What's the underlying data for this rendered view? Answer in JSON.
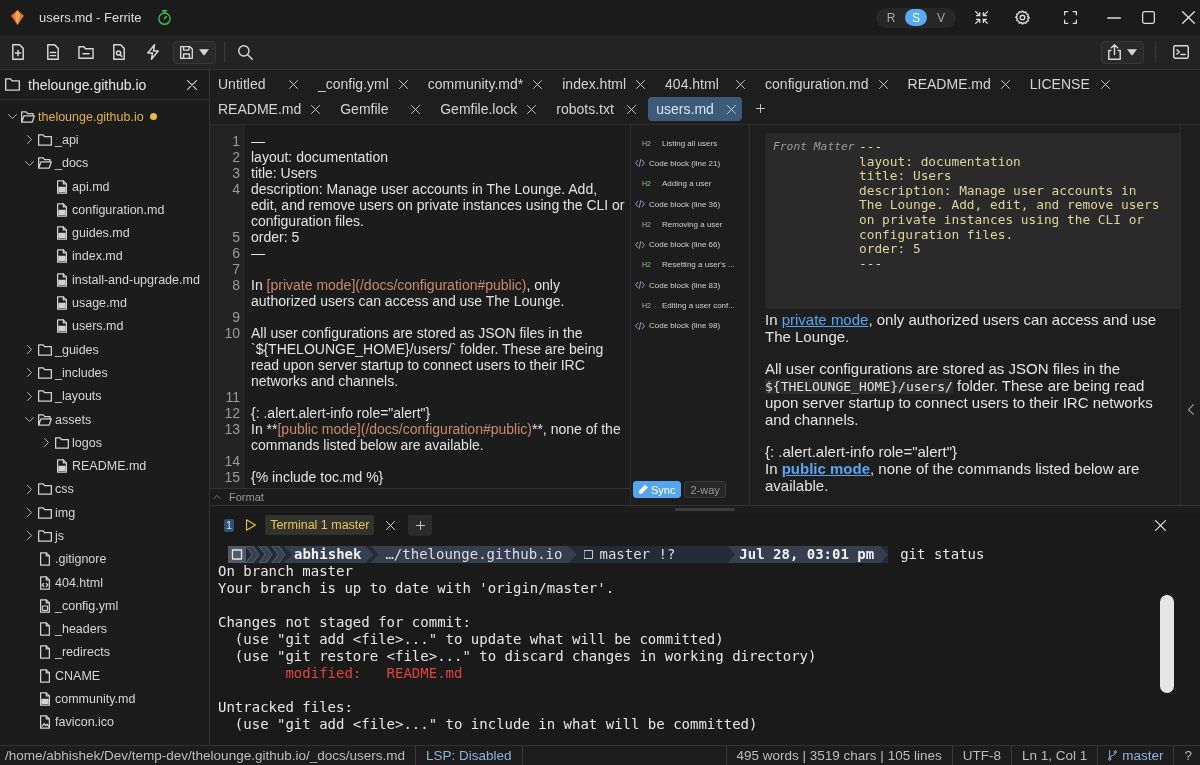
{
  "window": {
    "title": "users.md - Ferrite",
    "view_modes": [
      {
        "label": "R",
        "selected": false
      },
      {
        "label": "S",
        "selected": true
      },
      {
        "label": "V",
        "selected": false
      }
    ]
  },
  "sidebar": {
    "title": "thelounge.github.io",
    "tree": [
      {
        "name": "thelounge.github.io",
        "kind": "folder",
        "expanded": true,
        "modified": true,
        "children": [
          {
            "name": "_api",
            "kind": "folder",
            "expanded": false,
            "modified": false
          },
          {
            "name": "_docs",
            "kind": "folder",
            "expanded": true,
            "modified": false,
            "children": [
              {
                "name": "api.md",
                "kind": "markdown",
                "modified": false
              },
              {
                "name": "configuration.md",
                "kind": "markdown",
                "modified": false
              },
              {
                "name": "guides.md",
                "kind": "markdown",
                "modified": false
              },
              {
                "name": "index.md",
                "kind": "markdown",
                "modified": false
              },
              {
                "name": "install-and-upgrade.md",
                "kind": "markdown",
                "modified": false
              },
              {
                "name": "usage.md",
                "kind": "markdown",
                "modified": false
              },
              {
                "name": "users.md",
                "kind": "markdown",
                "modified": false
              }
            ]
          },
          {
            "name": "_guides",
            "kind": "folder",
            "expanded": false,
            "modified": false
          },
          {
            "name": "_includes",
            "kind": "folder",
            "expanded": false,
            "modified": false
          },
          {
            "name": "_layouts",
            "kind": "folder",
            "expanded": false,
            "modified": false
          },
          {
            "name": "assets",
            "kind": "folder",
            "expanded": true,
            "modified": false,
            "children": [
              {
                "name": "logos",
                "kind": "folder",
                "expanded": false,
                "modified": false
              },
              {
                "name": "README.md",
                "kind": "markdown",
                "modified": false
              }
            ]
          },
          {
            "name": "css",
            "kind": "folder",
            "expanded": false,
            "modified": false
          },
          {
            "name": "img",
            "kind": "folder",
            "expanded": false,
            "modified": false
          },
          {
            "name": "js",
            "kind": "folder",
            "expanded": false,
            "modified": false
          },
          {
            "name": ".gitignore",
            "kind": "file",
            "modified": false
          },
          {
            "name": "404.html",
            "kind": "html",
            "modified": false
          },
          {
            "name": "_config.yml",
            "kind": "config",
            "modified": false
          },
          {
            "name": "_headers",
            "kind": "file",
            "modified": false
          },
          {
            "name": "_redirects",
            "kind": "file",
            "modified": false
          },
          {
            "name": "CNAME",
            "kind": "file",
            "modified": false
          },
          {
            "name": "community.md",
            "kind": "markdown",
            "modified": false
          },
          {
            "name": "favicon.ico",
            "kind": "image",
            "modified": false
          }
        ]
      }
    ]
  },
  "tabs": [
    {
      "label": "Untitled",
      "selected": false
    },
    {
      "label": "_config.yml",
      "selected": false
    },
    {
      "label": "community.md*",
      "selected": false
    },
    {
      "label": "index.html",
      "selected": false
    },
    {
      "label": "404.html",
      "selected": false
    },
    {
      "label": "configuration.md",
      "selected": false
    },
    {
      "label": "README.md",
      "selected": false
    },
    {
      "label": "LICENSE",
      "selected": false
    },
    {
      "label": "README.md",
      "selected": false
    },
    {
      "label": "Gemfile",
      "selected": false
    },
    {
      "label": "Gemfile.lock",
      "selected": false
    },
    {
      "label": "robots.txt",
      "selected": false
    },
    {
      "label": "users.md",
      "selected": true
    }
  ],
  "editor": {
    "lines": [
      {
        "number": "1",
        "segments": [
          {
            "kind": "text",
            "text": "—"
          }
        ]
      },
      {
        "number": "2",
        "segments": [
          {
            "kind": "text",
            "text": "layout: documentation"
          }
        ]
      },
      {
        "number": "3",
        "segments": [
          {
            "kind": "text",
            "text": "title: Users"
          }
        ]
      },
      {
        "number": "4",
        "segments": [
          {
            "kind": "text",
            "text": "description: Manage user accounts in The Lounge. Add, edit, and remove users on private instances using the CLI or configuration files."
          }
        ]
      },
      {
        "number": "5",
        "segments": [
          {
            "kind": "text",
            "text": "order: 5"
          }
        ]
      },
      {
        "number": "6",
        "segments": [
          {
            "kind": "text",
            "text": "—"
          }
        ]
      },
      {
        "number": "7"
      },
      {
        "number": "8",
        "segments": [
          {
            "kind": "text",
            "text": "In "
          },
          {
            "kind": "link",
            "text": "[private mode](/docs/configuration#public)"
          },
          {
            "kind": "text",
            "text": ", only authorized users can access and use The Lounge."
          }
        ]
      },
      {
        "number": "9"
      },
      {
        "number": "10",
        "segments": [
          {
            "kind": "text",
            "text": "All user configurations are stored as JSON files in the `${THELOUNGE_HOME}/users/` folder. These are being read upon server startup to connect users to their IRC networks and channels."
          }
        ]
      },
      {
        "number": "11"
      },
      {
        "number": "12",
        "segments": [
          {
            "kind": "text",
            "text": "{: .alert.alert-info role=\"alert\"}"
          }
        ]
      },
      {
        "number": "13",
        "segments": [
          {
            "kind": "text",
            "text": "In **"
          },
          {
            "kind": "link",
            "text": "[public mode](/docs/configuration#public)"
          },
          {
            "kind": "text",
            "text": "**, none of the commands listed below are available."
          }
        ]
      },
      {
        "number": "14"
      },
      {
        "number": "15",
        "segments": [
          {
            "kind": "text",
            "text": "{% include toc.md %}"
          }
        ]
      }
    ],
    "outline": [
      {
        "kind": "heading",
        "tag": "H2",
        "text": "Listing all users"
      },
      {
        "kind": "code",
        "text": "Code block (line 21)"
      },
      {
        "kind": "heading",
        "tag": "H2",
        "text": "Adding a user"
      },
      {
        "kind": "code",
        "text": "Code block (line 36)"
      },
      {
        "kind": "heading",
        "tag": "H2",
        "text": "Removing a user"
      },
      {
        "kind": "code",
        "text": "Code block (line 66)"
      },
      {
        "kind": "heading",
        "tag": "H2",
        "text": "Resetting a user's ..."
      },
      {
        "kind": "code",
        "text": "Code block (line 83)"
      },
      {
        "kind": "heading",
        "tag": "H2",
        "text": "Editing a user conf..."
      },
      {
        "kind": "code",
        "text": "Code block (line 98)"
      }
    ],
    "sync": {
      "label": "Sync",
      "on": true
    },
    "two_way": {
      "label": "2-way",
      "on": false
    },
    "format": "Format"
  },
  "preview": {
    "front_matter": {
      "label": "Front Matter",
      "lines": [
        "---",
        "layout: documentation",
        "title: Users",
        "description: Manage user accounts in The Lounge. Add, edit, and remove users on private instances using the CLI or configuration files.",
        "order: 5",
        "---"
      ]
    },
    "paragraphs": [
      {
        "lines": [
          [
            {
              "kind": "text",
              "text": "In "
            },
            {
              "kind": "link",
              "bold": false,
              "text": "private mode"
            },
            {
              "kind": "text",
              "text": ", only authorized users can access and use The Lounge."
            }
          ]
        ]
      },
      {
        "lines": [
          [
            {
              "kind": "text",
              "text": "All user configurations are stored as JSON files in the "
            },
            {
              "kind": "code",
              "text": "${THELOUNGE_HOME}/users/"
            },
            {
              "kind": "text",
              "text": " folder. These are being read upon server startup to connect users to their IRC networks and channels."
            }
          ]
        ]
      },
      {
        "lines": [
          [
            {
              "kind": "text",
              "text": "{: .alert.alert-info role=\"alert\"}"
            }
          ],
          [
            {
              "kind": "text",
              "text": "In "
            },
            {
              "kind": "link",
              "bold": true,
              "text": "public mode"
            },
            {
              "kind": "text",
              "text": ", none of the commands listed below are available."
            }
          ]
        ]
      }
    ]
  },
  "terminal": {
    "tabs": [
      {
        "index": "1",
        "label": "Terminal 1 master",
        "selected": true
      }
    ],
    "prompt": {
      "user": "abhishek",
      "path": "…/thelounge.github.io",
      "branch": "master !?",
      "time": "Jul 28, 03:01 pm",
      "command": "git status"
    },
    "output": [
      {
        "kind": "text",
        "text": "On branch master"
      },
      {
        "kind": "text",
        "text": "Your branch is up to date with 'origin/master'."
      },
      {
        "kind": "blank"
      },
      {
        "kind": "text",
        "text": "Changes not staged for commit:"
      },
      {
        "kind": "hint",
        "text": "(use \"git add <file>...\" to update what will be committed)"
      },
      {
        "kind": "hint",
        "text": "(use \"git restore <file>...\" to discard changes in working directory)"
      },
      {
        "kind": "modified",
        "text": "modified:   README.md"
      },
      {
        "kind": "blank"
      },
      {
        "kind": "text",
        "text": "Untracked files:"
      },
      {
        "kind": "hint",
        "text": "(use \"git add <file>...\" to include in what will be committed)"
      }
    ]
  },
  "status_bar": {
    "path": "/home/abhishek/Dev/temp-dev/thelounge.github.io/_docs/users.md",
    "lsp": "LSP: Disabled",
    "counts": "495 words | 3519 chars | 105 lines",
    "encoding": "UTF-8",
    "position": "Ln 1, Col 1",
    "branch": "master",
    "help": "?"
  }
}
